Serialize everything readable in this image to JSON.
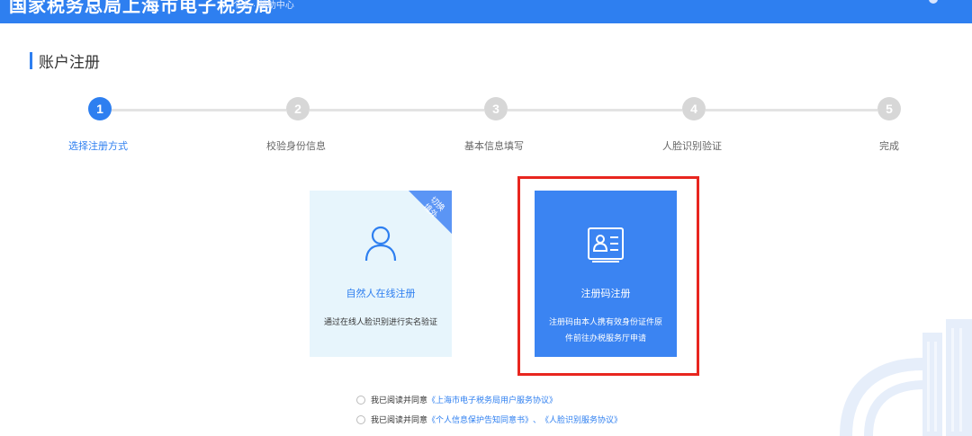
{
  "header": {
    "title": "国家税务总局上海市电子税务局",
    "subtitle": "个人 · 帮助中心"
  },
  "section_title": "账户注册",
  "steps": [
    {
      "number": "1",
      "label": "选择注册方式",
      "active": true
    },
    {
      "number": "2",
      "label": "校验身份信息",
      "active": false
    },
    {
      "number": "3",
      "label": "基本信息填写",
      "active": false
    },
    {
      "number": "4",
      "label": "人脸识别验证",
      "active": false
    },
    {
      "number": "5",
      "label": "完成",
      "active": false
    }
  ],
  "cards": {
    "natural": {
      "corner": "切换 境外",
      "title": "自然人在线注册",
      "desc": "通过在线人脸识别进行实名验证",
      "icon": "person-icon"
    },
    "code": {
      "title": "注册码注册",
      "desc": "注册码由本人携有效身份证件原件前往办税服务厅申请",
      "icon": "id-card-icon"
    }
  },
  "agreements": [
    {
      "prefix": "我已阅读并同意",
      "links": [
        "《上海市电子税务局用户服务协议》"
      ]
    },
    {
      "prefix": "我已阅读并同意",
      "links": [
        "《个人信息保护告知同意书》",
        "、",
        "《人脸识别服务协议》"
      ]
    }
  ],
  "colors": {
    "primary": "#2e7ff0",
    "highlight": "#e8261f",
    "card_light": "#e7f5fc"
  }
}
